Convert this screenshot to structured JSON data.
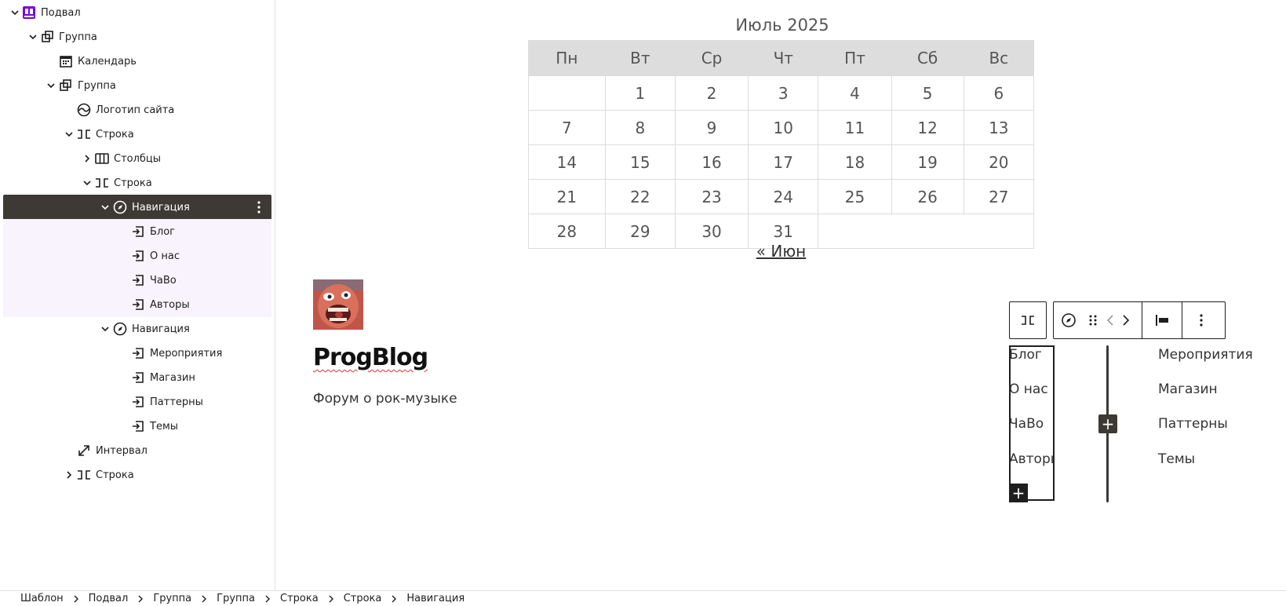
{
  "list_view": {
    "rows": [
      {
        "label": "Подвал",
        "icon": "template-part-icon"
      },
      {
        "label": "Группа",
        "icon": "group-icon"
      },
      {
        "label": "Календарь",
        "icon": "calendar-icon"
      },
      {
        "label": "Группа",
        "icon": "group-icon"
      },
      {
        "label": "Логотип сайта",
        "icon": "site-logo-icon"
      },
      {
        "label": "Строка",
        "icon": "row-icon"
      },
      {
        "label": "Столбцы",
        "icon": "columns-icon"
      },
      {
        "label": "Строка",
        "icon": "row-icon"
      },
      {
        "label": "Навигация",
        "icon": "navigation-icon"
      },
      {
        "label": "Блог",
        "icon": "nav-link-icon"
      },
      {
        "label": "О нас",
        "icon": "nav-link-icon"
      },
      {
        "label": "ЧаВо",
        "icon": "nav-link-icon"
      },
      {
        "label": "Авторы",
        "icon": "nav-link-icon"
      },
      {
        "label": "Навигация",
        "icon": "navigation-icon"
      },
      {
        "label": "Мероприятия",
        "icon": "nav-link-icon"
      },
      {
        "label": "Магазин",
        "icon": "nav-link-icon"
      },
      {
        "label": "Паттерны",
        "icon": "nav-link-icon"
      },
      {
        "label": "Темы",
        "icon": "nav-link-icon"
      },
      {
        "label": "Интервал",
        "icon": "spacer-icon"
      },
      {
        "label": "Строка",
        "icon": "row-icon"
      }
    ]
  },
  "calendar": {
    "caption": "Июль 2025",
    "weekdays": [
      "Пн",
      "Вт",
      "Ср",
      "Чт",
      "Пт",
      "Сб",
      "Вс"
    ],
    "weeks": [
      [
        "",
        "1",
        "2",
        "3",
        "4",
        "5",
        "6"
      ],
      [
        "7",
        "8",
        "9",
        "10",
        "11",
        "12",
        "13"
      ],
      [
        "14",
        "15",
        "16",
        "17",
        "18",
        "19",
        "20"
      ],
      [
        "21",
        "22",
        "23",
        "24",
        "25",
        "26",
        "27"
      ],
      [
        "28",
        "29",
        "30",
        "31",
        "",
        "",
        ""
      ]
    ],
    "prev_link": "« Июн"
  },
  "site": {
    "title": "ProgBlog",
    "tagline": "Форум о рок-музыке"
  },
  "nav_left": [
    "Блог",
    "О нас",
    "ЧаВо",
    "Авторы"
  ],
  "nav_right": [
    "Мероприятия",
    "Магазин",
    "Паттерны",
    "Темы"
  ],
  "toolbar": {
    "icons": [
      "row-icon",
      "navigation-icon",
      "drag-handle-icon",
      "move-left-icon",
      "move-right-icon",
      "justify-left-icon",
      "more-options-icon"
    ]
  },
  "breadcrumbs": [
    "Шаблон",
    "Подвал",
    "Группа",
    "Группа",
    "Строка",
    "Строка",
    "Навигация"
  ],
  "colors": {
    "accent": "#7a00df",
    "selected_bg": "#3d3a36",
    "nested_bg": "#f8f3fd"
  }
}
